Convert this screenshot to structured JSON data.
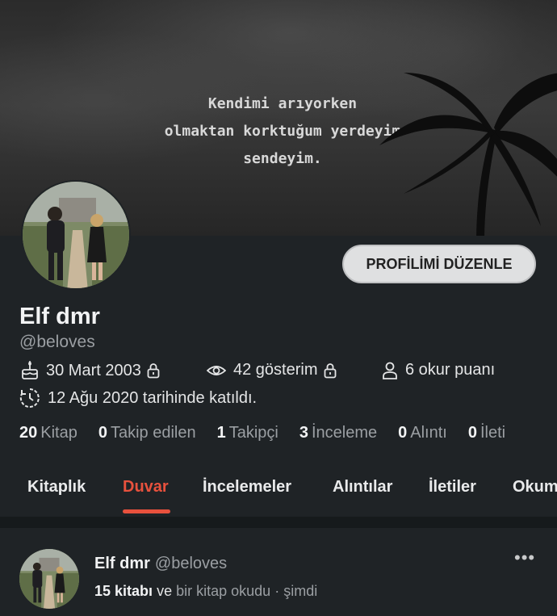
{
  "cover": {
    "quote_lines": [
      "Kendimi arıyorken",
      "olmaktan korktuğum yerdeyim",
      "sendeyim."
    ]
  },
  "profile": {
    "edit_button": "PROFİLİMİ DÜZENLE",
    "name": "Elf dmr",
    "handle": "@beloves",
    "birthday": "30 Mart 2003",
    "views": "42 gösterim",
    "reader_points": "6 okur puanı",
    "joined": "12 Ağu 2020 tarihinde katıldı."
  },
  "stats": [
    {
      "count": "20",
      "label": "Kitap"
    },
    {
      "count": "0",
      "label": "Takip edilen"
    },
    {
      "count": "1",
      "label": "Takipçi"
    },
    {
      "count": "3",
      "label": "İnceleme"
    },
    {
      "count": "0",
      "label": "Alıntı"
    },
    {
      "count": "0",
      "label": "İleti"
    }
  ],
  "tabs": [
    {
      "label": "Kitaplık"
    },
    {
      "label": "Duvar",
      "active": true
    },
    {
      "label": "İncelemeler"
    },
    {
      "label": "Alıntılar"
    },
    {
      "label": "İletiler"
    },
    {
      "label": "Okum"
    }
  ],
  "post": {
    "author": "Elf dmr",
    "handle": "@beloves",
    "count_text": "15 kitabı",
    "connector": "ve",
    "activity": "bir kitap okudu",
    "separator": "·",
    "time": "şimdi",
    "more": "•••"
  },
  "colors": {
    "accent": "#e8513d",
    "background": "#1f2326",
    "muted_text": "#9b9fa3"
  },
  "icons": {
    "birthday": "cake-icon",
    "views": "eye-icon",
    "points": "person-icon",
    "joined": "clock-icon",
    "private": "lock-icon"
  }
}
